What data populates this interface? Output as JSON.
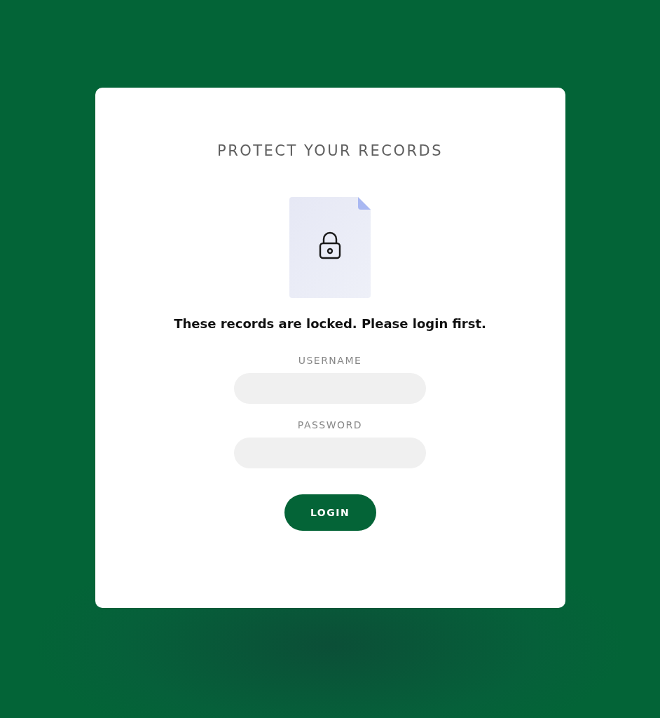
{
  "title": "PROTECT YOUR RECORDS",
  "message": "These records are locked. Please login first.",
  "fields": [
    {
      "label": "USERNAME"
    },
    {
      "label": "PASSWORD"
    }
  ],
  "login_button": "LOGIN"
}
